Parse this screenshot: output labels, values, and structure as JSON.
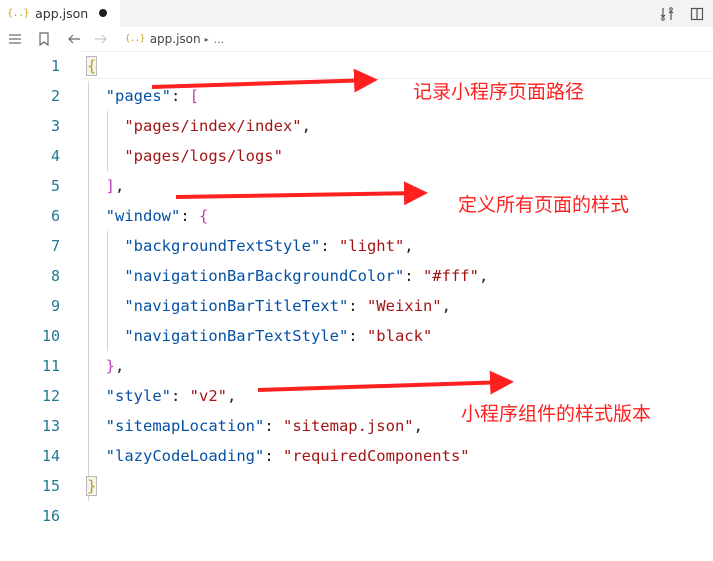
{
  "tab": {
    "icon": "{..}",
    "label": "app.json",
    "modified_dot": "●"
  },
  "toolbar_icons": [
    "compare-changes-icon",
    "split-editor-icon"
  ],
  "breadcrumb": {
    "tools": [
      "list-icon",
      "bookmark-icon",
      "back-arrow-icon",
      "forward-arrow-icon"
    ],
    "file_icon": "{..}",
    "file": "app.json",
    "separator": "▸",
    "ellipsis": "..."
  },
  "editor": {
    "line_numbers": [
      "1",
      "2",
      "3",
      "4",
      "5",
      "6",
      "7",
      "8",
      "9",
      "10",
      "11",
      "12",
      "13",
      "14",
      "15",
      "16"
    ],
    "active_line": 1
  },
  "code": {
    "l1_brace": "{",
    "l2_key": "\"pages\"",
    "l2_colon": ": ",
    "l2_bracket": "[",
    "l3_val": "\"pages/index/index\"",
    "l3_comma": ",",
    "l4_val": "\"pages/logs/logs\"",
    "l5_bracket": "]",
    "l5_comma": ",",
    "l6_key": "\"window\"",
    "l6_colon": ": ",
    "l6_brace": "{",
    "l7_key": "\"backgroundTextStyle\"",
    "l7_colon": ": ",
    "l7_val": "\"light\"",
    "l7_comma": ",",
    "l8_key": "\"navigationBarBackgroundColor\"",
    "l8_colon": ": ",
    "l8_val": "\"#fff\"",
    "l8_comma": ",",
    "l9_key": "\"navigationBarTitleText\"",
    "l9_colon": ": ",
    "l9_val": "\"Weixin\"",
    "l9_comma": ",",
    "l10_key": "\"navigationBarTextStyle\"",
    "l10_colon": ": ",
    "l10_val": "\"black\"",
    "l11_brace": "}",
    "l11_comma": ",",
    "l12_key": "\"style\"",
    "l12_colon": ": ",
    "l12_val": "\"v2\"",
    "l12_comma": ",",
    "l13_key": "\"sitemapLocation\"",
    "l13_colon": ": ",
    "l13_val": "\"sitemap.json\"",
    "l13_comma": ",",
    "l14_key": "\"lazyCodeLoading\"",
    "l14_colon": ": ",
    "l14_val": "\"requiredComponents\"",
    "l15_brace": "}"
  },
  "annotations": {
    "pages": "记录小程序页面路径",
    "window": "定义所有页面的样式",
    "style": "小程序组件的样式版本",
    "color": "#ff2020"
  },
  "colors": {
    "key": "#0451a5",
    "string": "#a31515",
    "line_number": "#237893",
    "bracket_level1": "#b5a022",
    "bracket_level2": "#c040b5"
  }
}
